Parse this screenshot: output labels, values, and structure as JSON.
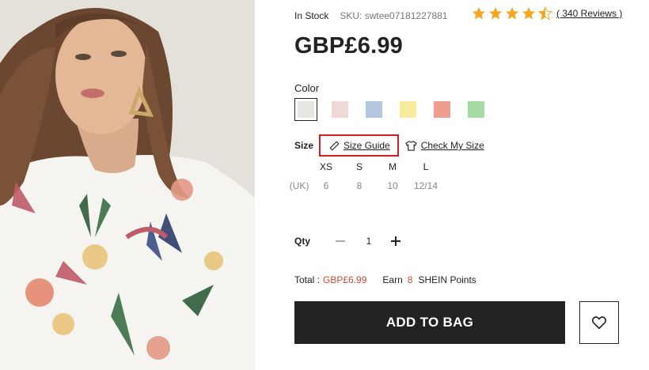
{
  "product": {
    "stock": "In Stock",
    "sku": "SKU: swtee07181227881",
    "rating": 4.5,
    "reviews": "( 340 Reviews )",
    "price": "GBP£6.99"
  },
  "color": {
    "label": "Color",
    "swatches": [
      "#e8e6e2",
      "#f0d8d6",
      "#b3c8df",
      "#f7ec9c",
      "#ef9d8c",
      "#a5dba5"
    ],
    "selected_index": 0
  },
  "size": {
    "label": "Size",
    "guide_label": "Size Guide",
    "check_label": "Check My Size",
    "sizes": [
      "XS",
      "S",
      "M",
      "L"
    ],
    "uk_label": "(UK)",
    "uk_values": [
      "6",
      "8",
      "10",
      "12/14"
    ]
  },
  "qty": {
    "label": "Qty",
    "value": "1"
  },
  "total": {
    "label": "Total :",
    "price": "GBP£6.99",
    "earn_label": "Earn",
    "points": "8",
    "points_label": "SHEIN Points"
  },
  "actions": {
    "add_to_bag": "ADD TO BAG"
  },
  "colors": {
    "star": "#f5a623",
    "highlight_border": "#cc1f1f",
    "accent_price": "#c44a3c",
    "button_bg": "#222222"
  }
}
